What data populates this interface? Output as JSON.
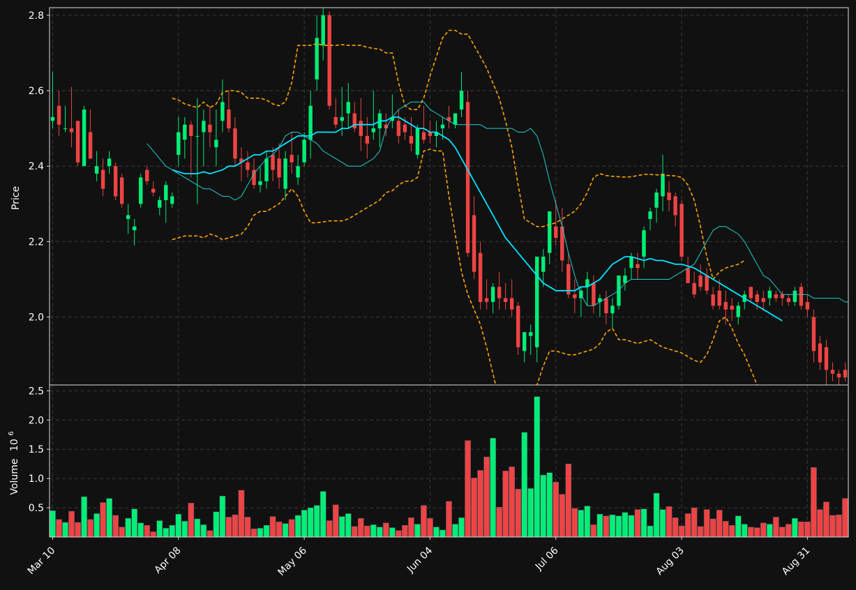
{
  "chart_data": {
    "type": "candlestick",
    "background": "#111111",
    "colors": {
      "up": "#00ee77",
      "down": "#ee4444",
      "sma_fast": "#22cccc",
      "sma_slow": "#00e5ff",
      "bands": "#ffa500",
      "grid": "#3a3a3a",
      "axis": "#dddddd",
      "text": "#ffffff"
    },
    "price_panel": {
      "ylabel": "Price",
      "ylim": [
        1.82,
        2.82
      ],
      "yticks": [
        "2.0",
        "2.2",
        "2.4",
        "2.6",
        "2.8"
      ],
      "ytick_values": [
        2.0,
        2.2,
        2.4,
        2.6,
        2.8
      ],
      "grid": true
    },
    "volume_panel": {
      "ylabel": "Volume",
      "unit_label": "10",
      "unit_exponent": "6",
      "ylim": [
        0,
        2.6
      ],
      "yticks": [
        "0.5",
        "1.0",
        "1.5",
        "2.0",
        "2.5"
      ],
      "ytick_values": [
        0.5,
        1.0,
        1.5,
        2.0,
        2.5
      ],
      "grid": true
    },
    "x_axis": {
      "tick_labels": [
        "Mar 10",
        "Apr 08",
        "May 06",
        "Jun 04",
        "Jul 06",
        "Aug 03",
        "Aug 31"
      ],
      "tick_indices": [
        0,
        20,
        40,
        60,
        80,
        100,
        120
      ],
      "n_bars": 127
    },
    "candles": [
      [
        2.52,
        2.65,
        2.5,
        2.53,
        0.45
      ],
      [
        2.56,
        2.6,
        2.48,
        2.51,
        0.3
      ],
      [
        2.5,
        2.56,
        2.49,
        2.5,
        0.25
      ],
      [
        2.5,
        2.61,
        2.45,
        2.49,
        0.44
      ],
      [
        2.52,
        2.52,
        2.4,
        2.41,
        0.25
      ],
      [
        2.4,
        2.56,
        2.4,
        2.55,
        0.69
      ],
      [
        2.49,
        2.55,
        2.42,
        2.42,
        0.3
      ],
      [
        2.38,
        2.44,
        2.36,
        2.4,
        0.4
      ],
      [
        2.39,
        2.42,
        2.32,
        2.34,
        0.59
      ],
      [
        2.4,
        2.44,
        2.38,
        2.42,
        0.66
      ],
      [
        2.4,
        2.41,
        2.31,
        2.32,
        0.37
      ],
      [
        2.37,
        2.38,
        2.29,
        2.3,
        0.17
      ],
      [
        2.26,
        2.3,
        2.22,
        2.27,
        0.32
      ],
      [
        2.23,
        2.26,
        2.19,
        2.24,
        0.48
      ],
      [
        2.3,
        2.38,
        2.29,
        2.37,
        0.24
      ],
      [
        2.39,
        2.4,
        2.35,
        2.36,
        0.2
      ],
      [
        2.34,
        2.36,
        2.32,
        2.33,
        0.09
      ],
      [
        2.29,
        2.32,
        2.27,
        2.31,
        0.28
      ],
      [
        2.31,
        2.36,
        2.25,
        2.35,
        0.15
      ],
      [
        2.3,
        2.33,
        2.29,
        2.32,
        0.2
      ],
      [
        2.43,
        2.53,
        2.4,
        2.49,
        0.39
      ],
      [
        2.47,
        2.53,
        2.42,
        2.51,
        0.27
      ],
      [
        2.51,
        2.52,
        2.37,
        2.48,
        0.58
      ],
      [
        2.48,
        2.58,
        2.3,
        2.48,
        0.31
      ],
      [
        2.49,
        2.55,
        2.4,
        2.52,
        0.21
      ],
      [
        2.51,
        2.56,
        2.45,
        2.49,
        0.11
      ],
      [
        2.45,
        2.55,
        2.4,
        2.47,
        0.43
      ],
      [
        2.52,
        2.63,
        2.49,
        2.57,
        0.7
      ],
      [
        2.55,
        2.6,
        2.49,
        2.5,
        0.34
      ],
      [
        2.5,
        2.53,
        2.4,
        2.42,
        0.38
      ],
      [
        2.42,
        2.45,
        2.36,
        2.41,
        0.8
      ],
      [
        2.41,
        2.44,
        2.37,
        2.39,
        0.34
      ],
      [
        2.39,
        2.42,
        2.34,
        2.35,
        0.14
      ],
      [
        2.35,
        2.4,
        2.33,
        2.36,
        0.15
      ],
      [
        2.36,
        2.44,
        2.34,
        2.42,
        0.2
      ],
      [
        2.43,
        2.45,
        2.36,
        2.39,
        0.35
      ],
      [
        2.42,
        2.46,
        2.34,
        2.37,
        0.26
      ],
      [
        2.34,
        2.44,
        2.31,
        2.42,
        0.23
      ],
      [
        2.43,
        2.49,
        2.38,
        2.41,
        0.3
      ],
      [
        2.37,
        2.43,
        2.35,
        2.4,
        0.37
      ],
      [
        2.41,
        2.49,
        2.4,
        2.47,
        0.46
      ],
      [
        2.47,
        2.6,
        2.42,
        2.56,
        0.5
      ],
      [
        2.63,
        2.8,
        2.6,
        2.74,
        0.54
      ],
      [
        2.72,
        2.82,
        2.68,
        2.8,
        0.78
      ],
      [
        2.8,
        2.81,
        2.55,
        2.56,
        0.28
      ],
      [
        2.53,
        2.58,
        2.5,
        2.51,
        0.55
      ],
      [
        2.52,
        2.61,
        2.48,
        2.53,
        0.35
      ],
      [
        2.54,
        2.62,
        2.5,
        2.57,
        0.4
      ],
      [
        2.54,
        2.57,
        2.49,
        2.5,
        0.18
      ],
      [
        2.52,
        2.58,
        2.44,
        2.48,
        0.32
      ],
      [
        2.48,
        2.53,
        2.42,
        2.46,
        0.19
      ],
      [
        2.49,
        2.6,
        2.47,
        2.5,
        0.21
      ],
      [
        2.5,
        2.55,
        2.45,
        2.54,
        0.17
      ],
      [
        2.51,
        2.54,
        2.48,
        2.5,
        0.24
      ],
      [
        2.52,
        2.59,
        2.5,
        2.53,
        0.16
      ],
      [
        2.52,
        2.55,
        2.46,
        2.48,
        0.11
      ],
      [
        2.51,
        2.53,
        2.47,
        2.49,
        0.2
      ],
      [
        2.48,
        2.53,
        2.44,
        2.46,
        0.33
      ],
      [
        2.43,
        2.51,
        2.42,
        2.5,
        0.22
      ],
      [
        2.49,
        2.56,
        2.46,
        2.47,
        0.54
      ],
      [
        2.49,
        2.52,
        2.46,
        2.48,
        0.32
      ],
      [
        2.48,
        2.52,
        2.45,
        2.49,
        0.17
      ],
      [
        2.5,
        2.53,
        2.47,
        2.51,
        0.12
      ],
      [
        2.53,
        2.56,
        2.5,
        2.52,
        0.61
      ],
      [
        2.51,
        2.54,
        2.5,
        2.54,
        0.22
      ],
      [
        2.55,
        2.65,
        2.53,
        2.6,
        0.33
      ],
      [
        2.57,
        2.6,
        2.16,
        2.17,
        1.65
      ],
      [
        2.27,
        2.32,
        2.1,
        2.12,
        1.01
      ],
      [
        2.17,
        2.2,
        2.02,
        2.04,
        1.14
      ],
      [
        2.05,
        2.1,
        2.02,
        2.04,
        1.37
      ],
      [
        2.04,
        2.09,
        2.01,
        2.08,
        1.69
      ],
      [
        2.08,
        2.12,
        2.02,
        2.05,
        0.51
      ],
      [
        2.05,
        2.09,
        2.02,
        2.04,
        1.13
      ],
      [
        2.05,
        2.1,
        2.0,
        2.02,
        1.2
      ],
      [
        2.03,
        2.04,
        1.9,
        1.92,
        0.82
      ],
      [
        1.91,
        1.96,
        1.88,
        1.96,
        1.79
      ],
      [
        1.95,
        1.98,
        1.9,
        1.96,
        0.83
      ],
      [
        1.92,
        2.05,
        1.88,
        2.16,
        2.4
      ],
      [
        2.12,
        2.18,
        2.08,
        2.16,
        1.06
      ],
      [
        2.17,
        2.28,
        2.14,
        2.28,
        1.1
      ],
      [
        2.24,
        2.31,
        2.19,
        2.21,
        0.94
      ],
      [
        2.24,
        2.29,
        2.12,
        2.15,
        0.73
      ],
      [
        2.14,
        2.17,
        2.05,
        2.06,
        1.25
      ],
      [
        2.06,
        2.1,
        2.01,
        2.05,
        0.49
      ],
      [
        2.05,
        2.08,
        2.0,
        2.07,
        0.46
      ],
      [
        2.08,
        2.12,
        2.03,
        2.1,
        0.53
      ],
      [
        2.09,
        2.11,
        2.01,
        2.03,
        0.21
      ],
      [
        2.04,
        2.06,
        2.0,
        2.05,
        0.39
      ],
      [
        2.05,
        2.07,
        1.98,
        2.01,
        0.36
      ],
      [
        2.01,
        2.05,
        1.97,
        2.03,
        0.38
      ],
      [
        2.03,
        2.11,
        2.02,
        2.11,
        0.36
      ],
      [
        2.09,
        2.13,
        2.07,
        2.11,
        0.42
      ],
      [
        2.13,
        2.17,
        2.1,
        2.16,
        0.37
      ],
      [
        2.14,
        2.17,
        2.1,
        2.13,
        0.47
      ],
      [
        2.16,
        2.24,
        2.13,
        2.23,
        0.48
      ],
      [
        2.26,
        2.29,
        2.23,
        2.28,
        0.19
      ],
      [
        2.29,
        2.34,
        2.25,
        2.33,
        0.75
      ],
      [
        2.32,
        2.43,
        2.28,
        2.38,
        0.47
      ],
      [
        2.33,
        2.36,
        2.28,
        2.31,
        0.52
      ],
      [
        2.32,
        2.33,
        2.24,
        2.27,
        0.33
      ],
      [
        2.3,
        2.31,
        2.15,
        2.16,
        0.19
      ],
      [
        2.13,
        2.16,
        2.09,
        2.09,
        0.4
      ],
      [
        2.09,
        2.12,
        2.05,
        2.06,
        0.5
      ],
      [
        2.11,
        2.14,
        2.07,
        2.08,
        0.18
      ],
      [
        2.11,
        2.13,
        2.06,
        2.07,
        0.47
      ],
      [
        2.06,
        2.08,
        2.02,
        2.03,
        0.31
      ],
      [
        2.07,
        2.1,
        2.02,
        2.03,
        0.46
      ],
      [
        2.04,
        2.07,
        1.98,
        2.02,
        0.27
      ],
      [
        2.03,
        2.05,
        1.99,
        2.02,
        0.2
      ],
      [
        2.0,
        2.04,
        1.98,
        2.03,
        0.36
      ],
      [
        2.04,
        2.07,
        2.02,
        2.06,
        0.22
      ],
      [
        2.08,
        2.08,
        2.04,
        2.05,
        0.17
      ],
      [
        2.06,
        2.07,
        2.02,
        2.04,
        0.16
      ],
      [
        2.05,
        2.07,
        2.02,
        2.04,
        0.24
      ],
      [
        2.05,
        2.08,
        2.03,
        2.07,
        0.22
      ],
      [
        2.06,
        2.07,
        2.04,
        2.05,
        0.34
      ],
      [
        2.06,
        2.07,
        2.03,
        2.05,
        0.17
      ],
      [
        2.05,
        2.06,
        2.03,
        2.04,
        0.22
      ],
      [
        2.04,
        2.08,
        2.03,
        2.07,
        0.32
      ],
      [
        2.08,
        2.09,
        2.02,
        2.03,
        0.26
      ],
      [
        2.04,
        2.06,
        2.0,
        2.02,
        0.26
      ],
      [
        2.0,
        2.02,
        1.88,
        1.91,
        1.19
      ],
      [
        1.93,
        1.95,
        1.86,
        1.88,
        0.47
      ],
      [
        1.92,
        1.94,
        1.82,
        1.86,
        0.6
      ],
      [
        1.86,
        1.88,
        1.83,
        1.85,
        0.37
      ],
      [
        1.85,
        1.86,
        1.82,
        1.84,
        0.38
      ],
      [
        1.86,
        1.88,
        1.83,
        1.84,
        0.66
      ]
    ],
    "sma_fast": {
      "start": 15,
      "values": [
        2.46,
        2.44,
        2.42,
        2.4,
        2.39,
        2.38,
        2.37,
        2.36,
        2.35,
        2.34,
        2.34,
        2.33,
        2.32,
        2.32,
        2.31,
        2.32,
        2.35,
        2.38,
        2.4,
        2.42,
        2.43,
        2.45,
        2.48,
        2.49,
        2.49,
        2.48,
        2.47,
        2.46,
        2.44,
        2.43,
        2.42,
        2.41,
        2.4,
        2.4,
        2.4,
        2.41,
        2.42,
        2.44,
        2.5,
        2.53,
        2.55,
        2.56,
        2.57,
        2.57,
        2.57,
        2.55,
        2.54,
        2.53,
        2.52,
        2.51,
        2.51,
        2.51,
        2.51,
        2.51,
        2.5,
        2.5,
        2.5,
        2.5,
        2.5,
        2.49,
        2.49,
        2.5,
        2.48,
        2.43,
        2.36,
        2.3,
        2.24,
        2.17,
        2.11,
        2.06,
        2.03,
        2.03,
        2.04,
        2.05,
        2.06,
        2.07,
        2.09,
        2.1,
        2.1,
        2.1,
        2.1,
        2.1,
        2.1,
        2.1,
        2.11,
        2.12,
        2.13,
        2.14,
        2.17,
        2.2,
        2.23,
        2.24,
        2.24,
        2.23,
        2.22,
        2.2,
        2.17,
        2.14,
        2.11,
        2.1,
        2.08,
        2.06,
        2.06,
        2.06,
        2.06,
        2.06,
        2.05,
        2.05,
        2.05,
        2.05,
        2.05,
        2.04,
        2.04,
        2.02,
        2.0,
        1.98,
        1.95
      ]
    },
    "sma_slow": {
      "start": 19,
      "values": [
        2.39,
        2.385,
        2.38,
        2.38,
        2.38,
        2.385,
        2.38,
        2.385,
        2.39,
        2.4,
        2.4,
        2.41,
        2.42,
        2.43,
        2.43,
        2.44,
        2.44,
        2.45,
        2.46,
        2.47,
        2.48,
        2.48,
        2.48,
        2.49,
        2.49,
        2.49,
        2.49,
        2.5,
        2.5,
        2.51,
        2.51,
        2.51,
        2.51,
        2.52,
        2.52,
        2.53,
        2.53,
        2.52,
        2.51,
        2.5,
        2.5,
        2.49,
        2.49,
        2.48,
        2.47,
        2.45,
        2.42,
        2.39,
        2.36,
        2.33,
        2.3,
        2.27,
        2.24,
        2.21,
        2.19,
        2.17,
        2.15,
        2.13,
        2.11,
        2.09,
        2.08,
        2.07,
        2.07,
        2.07,
        2.07,
        2.08,
        2.08,
        2.09,
        2.1,
        2.12,
        2.14,
        2.15,
        2.16,
        2.16,
        2.155,
        2.15,
        2.155,
        2.15,
        2.15,
        2.145,
        2.14,
        2.14,
        2.135,
        2.13,
        2.12,
        2.11,
        2.1,
        2.09,
        2.08,
        2.07,
        2.06,
        2.05,
        2.04,
        2.03,
        2.02,
        2.01,
        2.0,
        1.99
      ]
    },
    "bb_upper": {
      "start": 19,
      "values": [
        2.58,
        2.575,
        2.565,
        2.56,
        2.555,
        2.57,
        2.555,
        2.565,
        2.595,
        2.6,
        2.6,
        2.595,
        2.58,
        2.58,
        2.58,
        2.575,
        2.565,
        2.56,
        2.57,
        2.62,
        2.72,
        2.72,
        2.72,
        2.725,
        2.72,
        2.72,
        2.72,
        2.722,
        2.72,
        2.72,
        2.72,
        2.715,
        2.712,
        2.71,
        2.7,
        2.7,
        2.62,
        2.56,
        2.55,
        2.55,
        2.58,
        2.64,
        2.69,
        2.74,
        2.76,
        2.76,
        2.75,
        2.75,
        2.72,
        2.69,
        2.66,
        2.62,
        2.58,
        2.52,
        2.45,
        2.35,
        2.26,
        2.25,
        2.24,
        2.24,
        2.245,
        2.25,
        2.26,
        2.27,
        2.28,
        2.3,
        2.33,
        2.37,
        2.38,
        2.375,
        2.373,
        2.372,
        2.371,
        2.372,
        2.375,
        2.378,
        2.378,
        2.377,
        2.376,
        2.375,
        2.374,
        2.37,
        2.35,
        2.31,
        2.24,
        2.16,
        2.1,
        2.12,
        2.13,
        2.135,
        2.14,
        2.15
      ]
    },
    "bb_lower": {
      "start": 19,
      "values": [
        2.205,
        2.21,
        2.215,
        2.215,
        2.215,
        2.21,
        2.22,
        2.215,
        2.205,
        2.21,
        2.215,
        2.22,
        2.24,
        2.27,
        2.28,
        2.28,
        2.29,
        2.3,
        2.32,
        2.34,
        2.32,
        2.28,
        2.25,
        2.25,
        2.252,
        2.255,
        2.255,
        2.255,
        2.26,
        2.27,
        2.28,
        2.29,
        2.3,
        2.31,
        2.33,
        2.335,
        2.35,
        2.36,
        2.36,
        2.37,
        2.44,
        2.445,
        2.44,
        2.44,
        2.32,
        2.22,
        2.12,
        2.06,
        2.02,
        1.98,
        1.92,
        1.85,
        1.78,
        1.78,
        1.78,
        1.78,
        1.78,
        1.78,
        1.82,
        1.87,
        1.91,
        1.91,
        1.905,
        1.9,
        1.9,
        1.905,
        1.91,
        1.915,
        1.93,
        1.96,
        1.97,
        1.94,
        1.94,
        1.935,
        1.93,
        1.935,
        1.94,
        1.93,
        1.92,
        1.915,
        1.91,
        1.905,
        1.895,
        1.885,
        1.88,
        1.9,
        1.94,
        1.99,
        2.0,
        1.97,
        1.93,
        1.9,
        1.86,
        1.82
      ]
    }
  }
}
